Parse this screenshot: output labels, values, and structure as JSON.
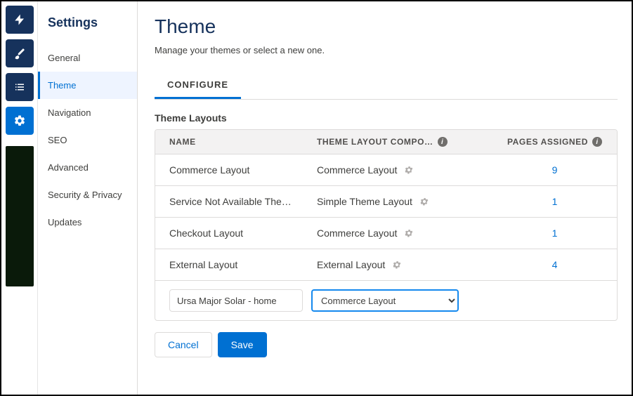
{
  "iconbar": {
    "items": [
      {
        "name": "lightning-icon"
      },
      {
        "name": "paintbrush-icon"
      },
      {
        "name": "list-icon"
      },
      {
        "name": "gear-icon"
      }
    ],
    "activeIndex": 3
  },
  "sidebar": {
    "title": "Settings",
    "items": [
      {
        "label": "General"
      },
      {
        "label": "Theme"
      },
      {
        "label": "Navigation"
      },
      {
        "label": "SEO"
      },
      {
        "label": "Advanced"
      },
      {
        "label": "Security & Privacy"
      },
      {
        "label": "Updates"
      }
    ],
    "selectedIndex": 1
  },
  "page": {
    "title": "Theme",
    "subtitle": "Manage your themes or select a new one."
  },
  "tabs": {
    "items": [
      {
        "label": "CONFIGURE"
      }
    ],
    "activeIndex": 0
  },
  "section": {
    "heading": "Theme Layouts",
    "columns": {
      "name": "NAME",
      "component": "THEME LAYOUT COMPO…",
      "pages": "PAGES ASSIGNED"
    },
    "rows": [
      {
        "name": "Commerce Layout",
        "component": "Commerce Layout",
        "pages": "9"
      },
      {
        "name": "Service Not Available The…",
        "component": "Simple Theme Layout",
        "pages": "1"
      },
      {
        "name": "Checkout Layout",
        "component": "Commerce Layout",
        "pages": "1"
      },
      {
        "name": "External Layout",
        "component": "External Layout",
        "pages": "4"
      }
    ],
    "newRow": {
      "nameValue": "Ursa Major Solar - home",
      "componentValue": "Commerce Layout"
    }
  },
  "buttons": {
    "cancel": "Cancel",
    "save": "Save"
  }
}
